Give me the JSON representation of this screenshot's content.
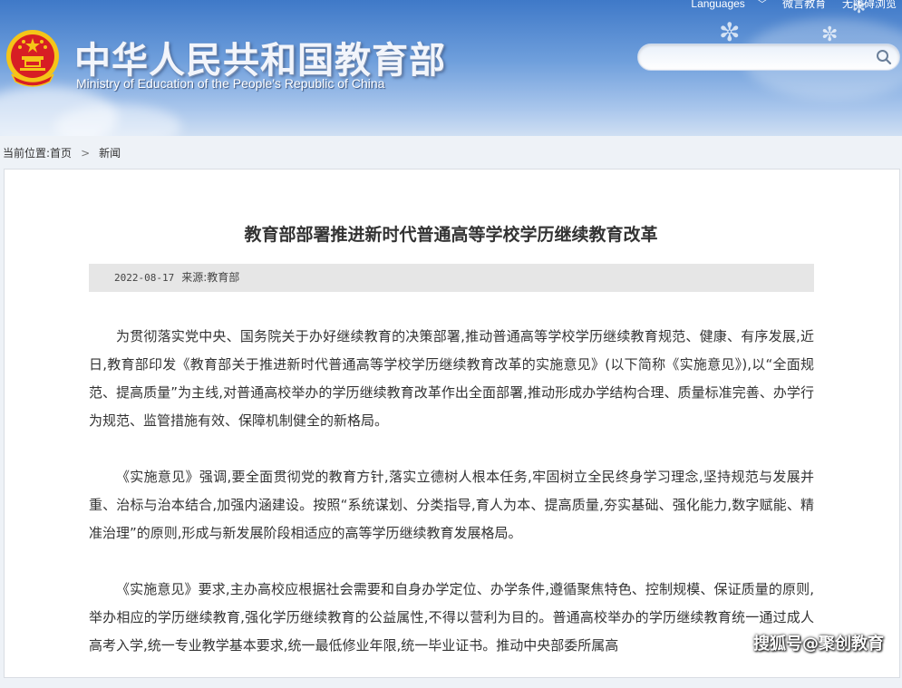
{
  "header": {
    "site_title": "中华人民共和国教育部",
    "site_subtitle": "Ministry of Education of the People's Republic of China",
    "links": {
      "languages": "Languages",
      "weibo": "微言教育",
      "accessibility": "无障碍浏览"
    },
    "search": {
      "placeholder": "",
      "value": ""
    }
  },
  "breadcrumb": {
    "prefix": "当前位置:",
    "home": "首页",
    "separator": ">",
    "current": "新闻"
  },
  "article": {
    "title": "教育部部署推进新时代普通高等学校学历继续教育改革",
    "date": "2022-08-17",
    "source": "来源:教育部",
    "paragraphs": [
      "为贯彻落实党中央、国务院关于办好继续教育的决策部署,推动普通高等学校学历继续教育规范、健康、有序发展,近日,教育部印发《教育部关于推进新时代普通高等学校学历继续教育改革的实施意见》(以下简称《实施意见》),以“全面规范、提高质量”为主线,对普通高校举办的学历继续教育改革作出全面部署,推动形成办学结构合理、质量标准完善、办学行为规范、监管措施有效、保障机制健全的新格局。",
      "《实施意见》强调,要全面贯彻党的教育方针,落实立德树人根本任务,牢固树立全民终身学习理念,坚持规范与发展并重、治标与治本结合,加强内涵建设。按照“系统谋划、分类指导,育人为本、提高质量,夯实基础、强化能力,数字赋能、精准治理”的原则,形成与新发展阶段相适应的高等学历继续教育发展格局。",
      "《实施意见》要求,主办高校应根据社会需要和自身办学定位、办学条件,遵循聚焦特色、控制规模、保证质量的原则,举办相应的学历继续教育,强化学历继续教育的公益属性,不得以营利为目的。普通高校举办的学历继续教育统一通过成人高考入学,统一专业教学基本要求,统一最低修业年限,统一毕业证书。推动中央部委所属高"
    ]
  },
  "watermark": "搜狐号@聚创教育",
  "colors": {
    "header_top": "#3f79c8",
    "header_bottom": "#cfdff3",
    "emblem_red": "#d71e24",
    "emblem_gold": "#f5c518",
    "meta_bar": "#e6e6e6"
  }
}
